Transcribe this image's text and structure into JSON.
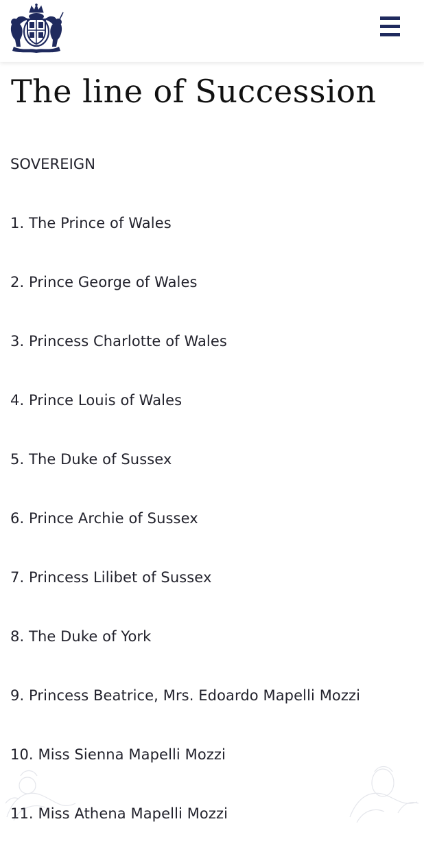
{
  "header": {
    "logo": "royal-coat-of-arms",
    "menu_icon": "hamburger-menu-icon",
    "accent_color": "#1f2a5e"
  },
  "page": {
    "title": "The line of Succession"
  },
  "succession": [
    "SOVEREIGN",
    "1. The Prince of Wales",
    "2. Prince George of Wales",
    "3. Princess Charlotte of Wales",
    "4. Prince Louis of Wales",
    "5. The Duke of Sussex",
    "6. Prince Archie of Sussex",
    "7. Princess Lilibet of Sussex",
    "8. The Duke of York",
    "9. Princess Beatrice, Mrs. Edoardo Mapelli Mozzi",
    "10. Miss Sienna Mapelli Mozzi",
    "11. Miss Athena Mapelli Mozzi"
  ]
}
